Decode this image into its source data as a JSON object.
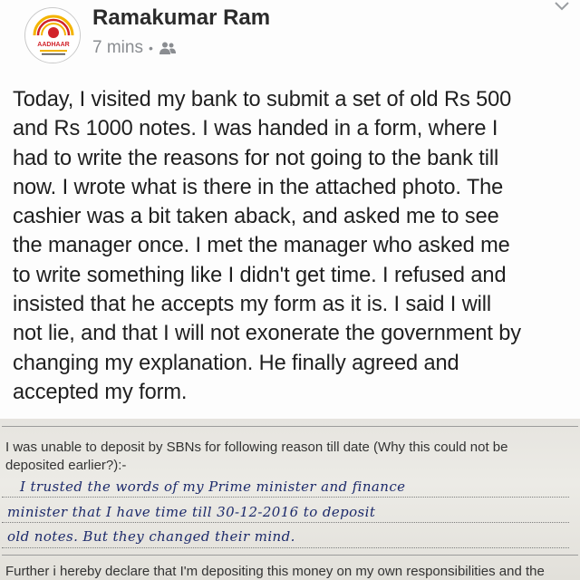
{
  "post": {
    "author": "Ramakumar Ram",
    "time": "7 mins",
    "separator": "•",
    "audience_icon": "friends-icon",
    "menu_icon": "chevron-down-icon",
    "avatar_logo": "aadhaar-logo",
    "lines": [
      "Today, I visited my bank to submit a set of old Rs 500",
      "and Rs 1000 notes. I was handed in a form, where I",
      "had to write the reasons for not going to the bank till",
      "now. I wrote what is there in the attached photo. The",
      "cashier was a bit taken aback, and asked me to see",
      "the manager once. I met the manager who asked me",
      "to write something like I didn't get time. I refused and",
      "insisted that he accepts my form as it is. I said I will",
      "not lie, and that I will not exonerate the government by",
      "changing my explanation. He finally agreed and",
      "accepted my form."
    ]
  },
  "photo": {
    "question_line1": "I was unable to deposit by SBNs for following reason till date (Why this could not be",
    "question_line2": "deposited earlier?):-",
    "handwritten": [
      "I trusted the words of my Prime minister and finance",
      "minister that I have time till 30-12-2016 to deposit",
      "old notes. But they changed their mind."
    ],
    "declaration": "Further i hereby declare that I'm depositing this money on my own responsibilities and the"
  },
  "colors": {
    "text": "#1f1f1f",
    "meta": "#8a8d91",
    "ink": "#1c2a6b",
    "paper": "#e8e6e1",
    "aadhaar_red": "#d2232a",
    "aadhaar_yellow": "#f4b400"
  }
}
